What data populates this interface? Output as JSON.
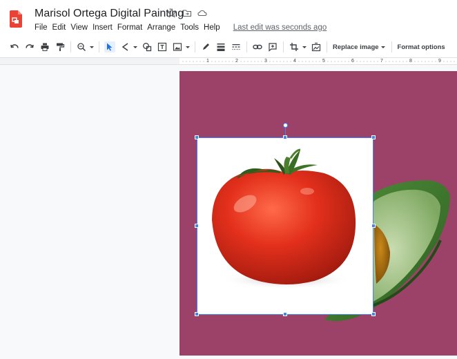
{
  "header": {
    "doc_title": "Marisol Ortega Digital Painting",
    "icons": [
      "star-icon",
      "move-to-folder-icon",
      "cloud-status-icon"
    ],
    "menu": [
      "File",
      "Edit",
      "View",
      "Insert",
      "Format",
      "Arrange",
      "Tools",
      "Help"
    ],
    "last_edit": "Last edit was seconds ago"
  },
  "toolbar": {
    "buttons": [
      "undo-icon",
      "redo-icon",
      "print-icon",
      "paint-format-icon",
      "zoom-icon",
      "select-icon",
      "line-icon",
      "shape-icon",
      "text-box-icon",
      "image-icon",
      "pen-color-icon",
      "line-weight-icon",
      "line-dash-icon",
      "link-icon",
      "comment-icon",
      "crop-icon",
      "mask-image-icon"
    ],
    "replace_image_label": "Replace image",
    "format_options_label": "Format options"
  },
  "ruler": {
    "labels": [
      "1",
      "2",
      "3",
      "4",
      "5",
      "6",
      "7",
      "8",
      "9"
    ]
  },
  "colors": {
    "accent": "#4285f4",
    "slide_background": "#9c4168",
    "app_logo": "#f4b400"
  }
}
